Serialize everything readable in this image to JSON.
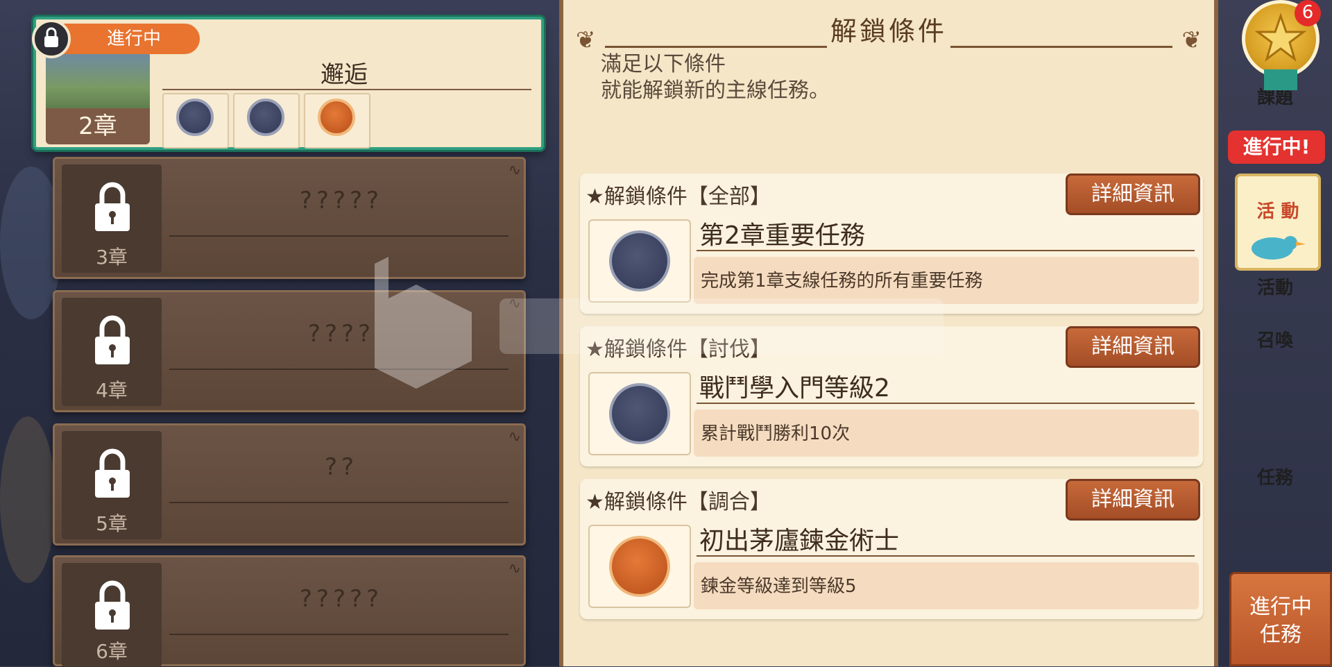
{
  "current_chapter": {
    "tag": "進行中",
    "title": "邂逅",
    "chapter_label": "2章"
  },
  "locked_chapters": [
    {
      "title": "?????",
      "chapter_label": "3章"
    },
    {
      "title": "????",
      "chapter_label": "4章"
    },
    {
      "title": "??",
      "chapter_label": "5章"
    },
    {
      "title": "?????",
      "chapter_label": "6章"
    }
  ],
  "panel": {
    "title": "解鎖條件",
    "description": "滿足以下條件\n就能解鎖新的主線任務。",
    "conditions": [
      {
        "header": "★解鎖條件【全部】",
        "button": "詳細資訊",
        "name": "第2章重要任務",
        "detail": "完成第1章支線任務的所有重要任務",
        "icon": "scroll-medal-icon"
      },
      {
        "header": "★解鎖條件【討伐】",
        "button": "詳細資訊",
        "name": "戰鬥學入門等級2",
        "detail": "累計戰鬥勝利10次",
        "icon": "cat-medal-icon"
      },
      {
        "header": "★解鎖條件【調合】",
        "button": "詳細資訊",
        "name": "初出茅廬鍊金術士",
        "detail": "鍊金等級達到等級5",
        "icon": "pot-medal-icon"
      }
    ]
  },
  "sidebar": {
    "tasks_label": "課題",
    "tasks_badge": "6",
    "in_progress_tag": "進行中!",
    "event_label": "活動",
    "event_card_text": "活 動",
    "summon_label": "召喚",
    "quest_label": "任務",
    "active_quest_button": "進行中\n任務"
  },
  "colors": {
    "accent_green": "#2fa081",
    "button_orange": "#b8552a",
    "panel_bg": "#f4e6c7"
  }
}
